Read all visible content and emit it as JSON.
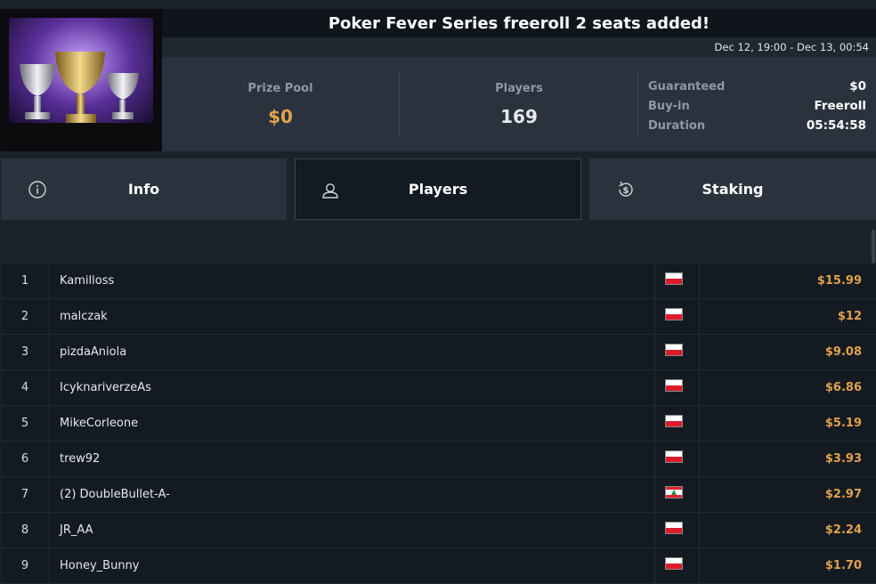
{
  "header": {
    "title": "Poker Fever Series freeroll 2 seats added!",
    "dates": "Dec 12, 19:00 - Dec 13, 00:54"
  },
  "summary": {
    "prize_pool_label": "Prize Pool",
    "prize_pool_value": "$0",
    "players_label": "Players",
    "players_value": "169",
    "details": [
      {
        "key": "Guaranteed",
        "value": "$0"
      },
      {
        "key": "Buy-in",
        "value": "Freeroll"
      },
      {
        "key": "Duration",
        "value": "05:54:58"
      }
    ]
  },
  "tabs": [
    {
      "label": "Info",
      "icon": "info-icon"
    },
    {
      "label": "Players",
      "icon": "user-icon",
      "active": true
    },
    {
      "label": "Staking",
      "icon": "dollar-coin-icon"
    }
  ],
  "players": [
    {
      "rank": "1",
      "name": "Kamilloss",
      "flag": "pl",
      "amount": "$15.99"
    },
    {
      "rank": "2",
      "name": "malczak",
      "flag": "pl",
      "amount": "$12"
    },
    {
      "rank": "3",
      "name": "pizdaAniola",
      "flag": "pl",
      "amount": "$9.08"
    },
    {
      "rank": "4",
      "name": "IcyknariverzeAs",
      "flag": "pl",
      "amount": "$6.86"
    },
    {
      "rank": "5",
      "name": "MikeCorleone",
      "flag": "pl",
      "amount": "$5.19"
    },
    {
      "rank": "6",
      "name": "trew92",
      "flag": "pl",
      "amount": "$3.93"
    },
    {
      "rank": "7",
      "name": "(2) DoubleBullet-A-",
      "flag": "lb",
      "amount": "$2.97"
    },
    {
      "rank": "8",
      "name": "JR_AA",
      "flag": "pl",
      "amount": "$2.24"
    },
    {
      "rank": "9",
      "name": "Honey_Bunny",
      "flag": "pl",
      "amount": "$1.70"
    }
  ],
  "colors": {
    "accent": "#e1a14c",
    "background": "#1b222c",
    "row_bg": "#141a21"
  }
}
